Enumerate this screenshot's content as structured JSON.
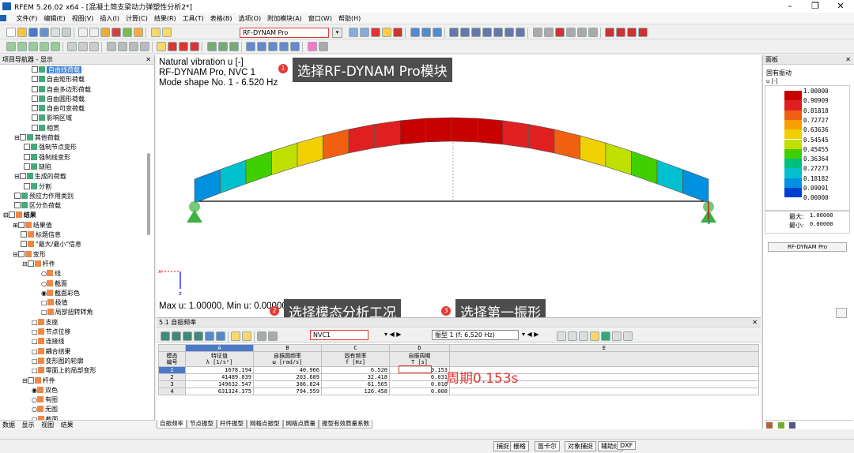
{
  "window": {
    "title": "RFEM 5.26.02 x64 - [混凝土简支梁动力弹塑性分析2*]",
    "min_label": "–",
    "restore_label": "❐",
    "close_label": "✕"
  },
  "menu": [
    "文件(F)",
    "编辑(E)",
    "视图(V)",
    "插入(I)",
    "计算(C)",
    "结果(R)",
    "工具(T)",
    "表格(B)",
    "选项(O)",
    "附加模块(A)",
    "窗口(W)",
    "帮助(H)"
  ],
  "toolbar": {
    "module_select": "RF-DYNAM Pro"
  },
  "navigator": {
    "title": "项目导航器 - 显示",
    "items": [
      "自由线荷载",
      "自由矩形荷载",
      "自由多边形荷载",
      "自由圆形荷载",
      "自由可变荷载",
      "影响区域",
      "相贯",
      "其他荷载",
      "强制节点变形",
      "强制线变形",
      "缺陷",
      "生成的荷载",
      "分割",
      "预应力作用类别",
      "区分负荷载",
      "结果",
      "结果值",
      "标题信息",
      "\"最大/最小\"信息",
      "变形",
      "杆件",
      "线",
      "截面",
      "截面彩色",
      "极值",
      "局部扭转转角",
      "支座",
      "节点位移",
      "连接线",
      "耦合结果",
      "变形图的轮廓",
      "零面上的局部变形",
      "杆件",
      "双色",
      "有图",
      "无图",
      "截面"
    ],
    "tabs": [
      "数据",
      "显示",
      "视图",
      "结果"
    ]
  },
  "viewport": {
    "line1": "Natural vibration u [-]",
    "line2": "RF-DYNAM Pro, NVC 1",
    "line3": "Mode shape No. 1 - 6.520 Hz",
    "footer": "Max u: 1.00000, Min u: 0.00000",
    "max_tag": "1.0000",
    "axis_x": "x",
    "axis_z": "z",
    "support_label": "z"
  },
  "callouts": [
    {
      "num": "1",
      "text": "选择RF-DYNAM Pro模块"
    },
    {
      "num": "2",
      "text": "选择模态分析工况"
    },
    {
      "num": "3",
      "text": "选择第一振形"
    }
  ],
  "period_note": "周期0.153s",
  "panel": {
    "title": "面板",
    "subtitle": "固有振动",
    "unit": "u [-]",
    "legend_values": [
      "1.00000",
      "0.90909",
      "0.81818",
      "0.72727",
      "0.63636",
      "0.54545",
      "0.45455",
      "0.36364",
      "0.27273",
      "0.18182",
      "0.09091",
      "0.00000"
    ],
    "legend_colors": [
      "#c80000",
      "#e02020",
      "#f06010",
      "#f8a000",
      "#f0d000",
      "#c0e000",
      "#40d000",
      "#00c080",
      "#00c0d0",
      "#0090e0",
      "#0040d0",
      "#000080"
    ],
    "max_label": "最大:",
    "max_value": "1.00000",
    "min_label": "最小:",
    "min_value": "0.00000",
    "button": "RF-DYNAM Pro"
  },
  "table": {
    "title": "5.1 自振频率",
    "case": "NVC1",
    "mode": "振型 1 (f: 6.520 Hz)",
    "col_letters": [
      "A",
      "B",
      "C",
      "D",
      "E"
    ],
    "headers": [
      "模态\n编号",
      "特征值\nλ [1/s²]",
      "自振圆频率\nω [rad/s]",
      "固有频率\nf [Hz]",
      "自振周期\nT [s]"
    ],
    "rows": [
      [
        "1",
        "1678.194",
        "40.966",
        "6.520",
        "0.153"
      ],
      [
        "2",
        "41489.039",
        "203.689",
        "32.418",
        "0.031"
      ],
      [
        "3",
        "149632.547",
        "386.824",
        "61.565",
        "0.016"
      ],
      [
        "4",
        "631324.375",
        "794.559",
        "126.458",
        "0.008"
      ]
    ],
    "tabs": [
      "自振频率",
      "节点振型",
      "杆件振型",
      "网格点振型",
      "网格点质量",
      "振型有效质量系数"
    ]
  },
  "status": [
    "捕捉",
    "栅格",
    "笛卡尔",
    "对象捕捉",
    "辅助线",
    "DXF"
  ]
}
